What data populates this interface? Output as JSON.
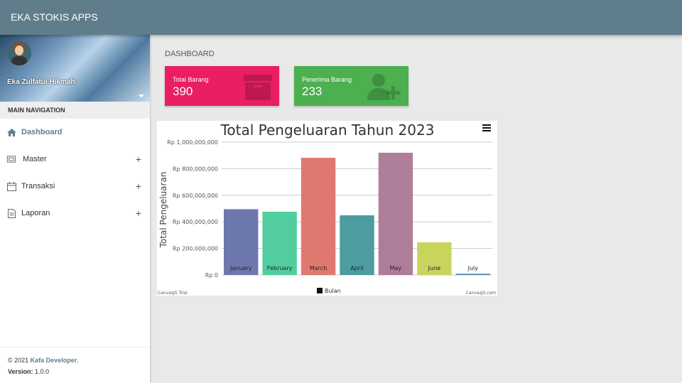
{
  "app": {
    "title": "EKA STOKIS APPS"
  },
  "user": {
    "name": "Eka Zulfatul Hikmah"
  },
  "sidebar": {
    "heading": "MAIN NAVIGATION",
    "items": [
      {
        "label": "Dashboard",
        "icon": "home-icon"
      },
      {
        "label": "Master",
        "icon": "frame-icon",
        "expand": "+"
      },
      {
        "label": "Transaksi",
        "icon": "calendar-icon",
        "expand": "+"
      },
      {
        "label": "Laporan",
        "icon": "document-icon",
        "expand": "+"
      }
    ]
  },
  "footer": {
    "copyright": "© 2021",
    "company": "Kafa Developer",
    "dot": ".",
    "version_label": "Version:",
    "version": "1.0.0"
  },
  "page": {
    "title": "DASHBOARD"
  },
  "cards": [
    {
      "label": "Total Barang",
      "value": "390",
      "color": "#e91e63",
      "icon": "archive-icon"
    },
    {
      "label": "Penerima Barang",
      "value": "233",
      "color": "#4caf50",
      "icon": "user-add-icon"
    }
  ],
  "chart_data": {
    "type": "bar",
    "title": "Total Pengeluaran Tahun 2023",
    "ylabel": "Total Pengeluaran",
    "xlabel": "",
    "legend": "Bulan",
    "legend_position": "bottom",
    "categories": [
      "January",
      "February",
      "March",
      "April",
      "May",
      "June",
      "July"
    ],
    "values": [
      495000000,
      476000000,
      882000000,
      449000000,
      920000000,
      246000000,
      10000000
    ],
    "colors": [
      "#6d78ad",
      "#51cda0",
      "#df7970",
      "#4c9ca0",
      "#ae7d99",
      "#c9d45c",
      "#5592ad"
    ],
    "ylim": [
      0,
      1000000000
    ],
    "yticks": [
      "Rp 0",
      "Rp 200,000,000",
      "Rp 400,000,000",
      "Rp 600,000,000",
      "Rp 800,000,000",
      "Rp 1,000,000,000"
    ],
    "grid": true,
    "credit_left": "CanvasJS Trial",
    "credit_right": "CanvasJS.com"
  }
}
